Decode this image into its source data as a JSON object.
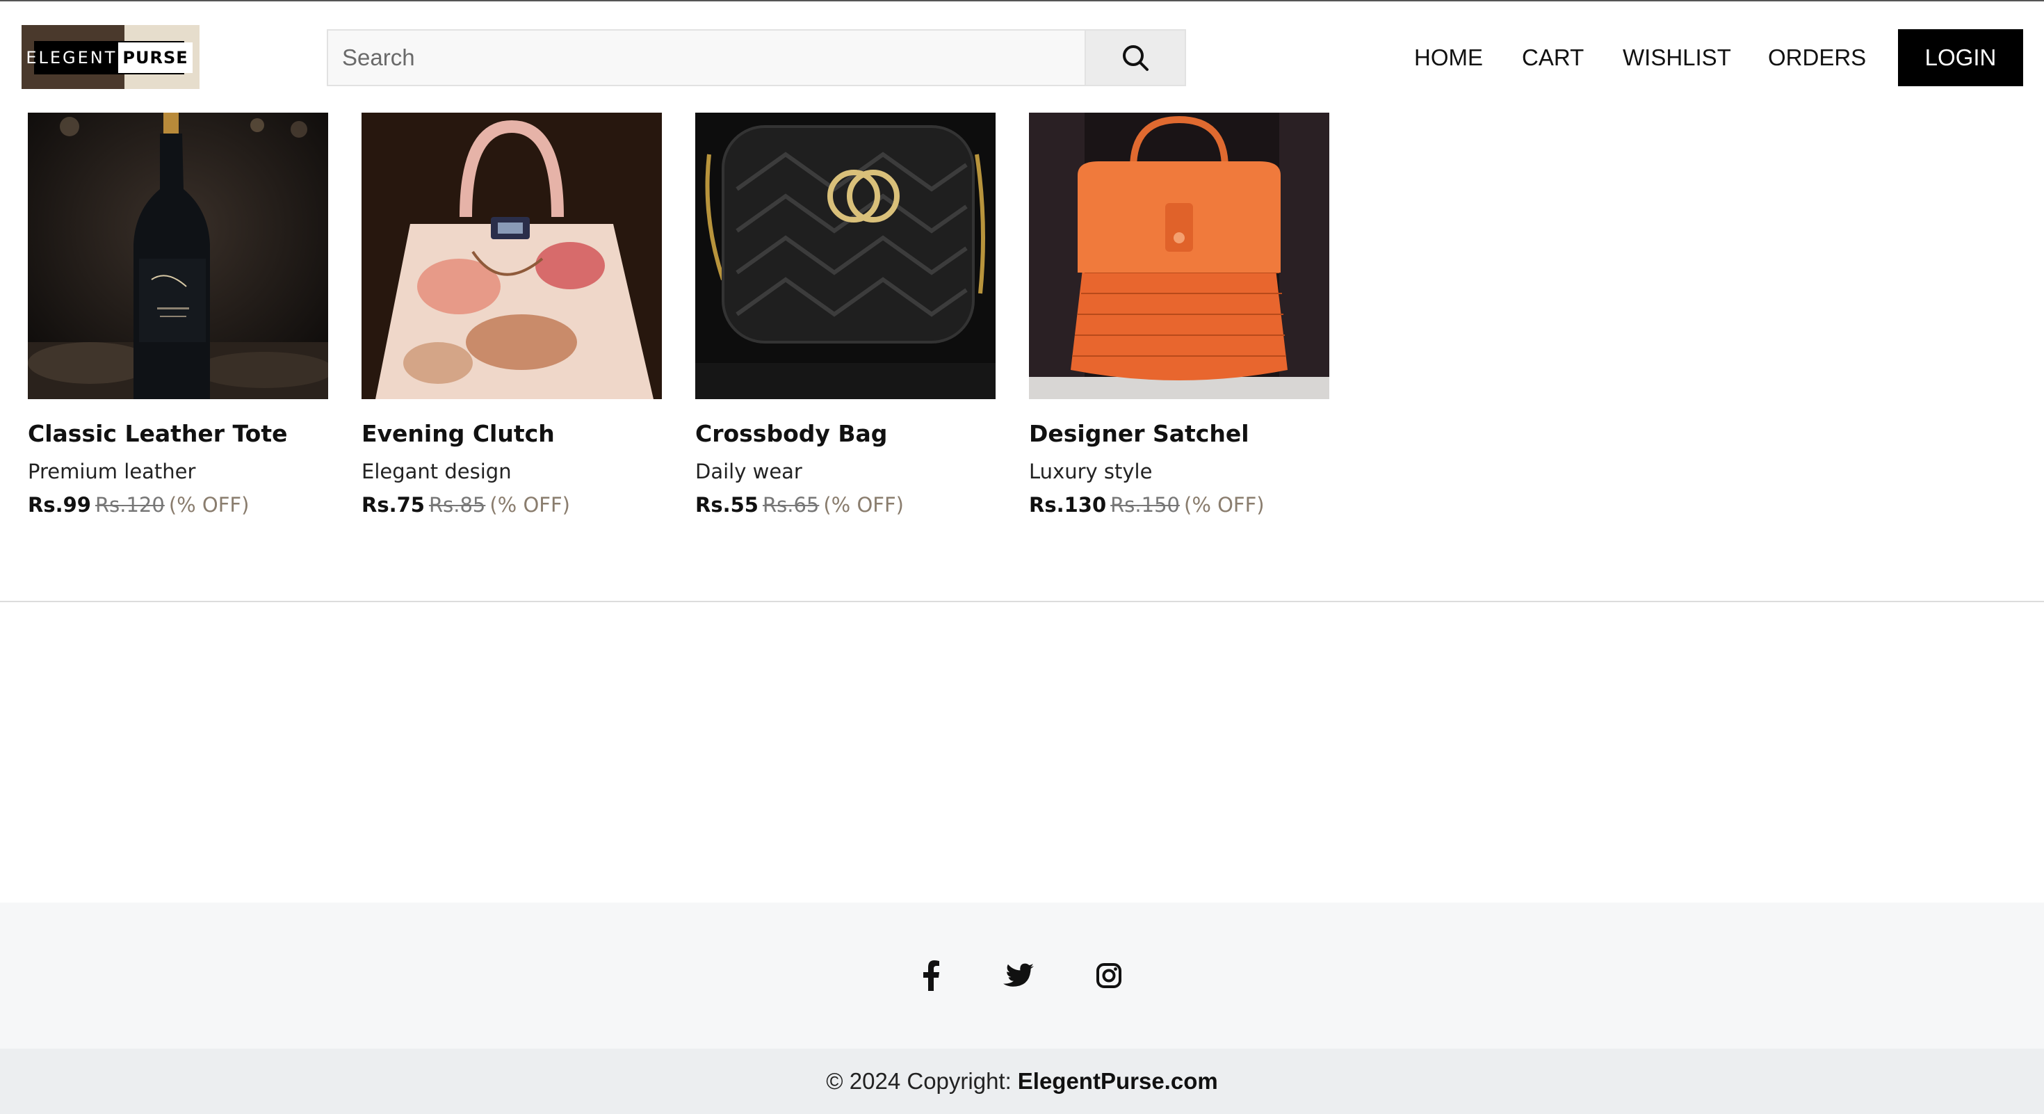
{
  "header": {
    "logo": {
      "word1": "ELEGENT",
      "word2": "PURSE"
    },
    "search": {
      "placeholder": "Search",
      "icon": "search-icon"
    },
    "nav": [
      {
        "label": "HOME"
      },
      {
        "label": "CART"
      },
      {
        "label": "WISHLIST"
      },
      {
        "label": "ORDERS"
      }
    ],
    "login_label": "LOGIN"
  },
  "products": [
    {
      "name": "Classic Leather Tote",
      "desc": "Premium leather",
      "price": "Rs.99",
      "mrp": "Rs.120",
      "off": "(% OFF)",
      "image": "wine-bottle-photo"
    },
    {
      "name": "Evening Clutch",
      "desc": "Elegant design",
      "price": "Rs.75",
      "mrp": "Rs.85",
      "off": "(% OFF)",
      "image": "floral-handbag-photo"
    },
    {
      "name": "Crossbody Bag",
      "desc": "Daily wear",
      "price": "Rs.55",
      "mrp": "Rs.65",
      "off": "(% OFF)",
      "image": "black-quilted-bag-photo"
    },
    {
      "name": "Designer Satchel",
      "desc": "Luxury style",
      "price": "Rs.130",
      "mrp": "Rs.150",
      "off": "(% OFF)",
      "image": "orange-wicker-bag-photo"
    }
  ],
  "footer": {
    "social": [
      "facebook-icon",
      "twitter-icon",
      "instagram-icon"
    ],
    "copyright_prefix": "© 2024 Copyright:",
    "copyright_site": "ElegentPurse.com"
  },
  "colors": {
    "logo_dark": "#4a392c",
    "logo_light": "#e6ddcc",
    "login_bg": "#000000",
    "discount_text": "#8a7d6e",
    "footer_social_bg": "#f6f7f8",
    "footer_copy_bg": "#eceef0"
  }
}
